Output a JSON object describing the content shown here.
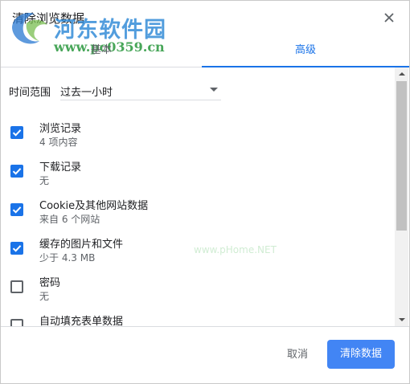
{
  "dialog": {
    "title": "清除浏览数据",
    "close_icon": "close-icon"
  },
  "watermark": {
    "name": "河东软件园",
    "url": "www.pc0359.cn",
    "faint": "www.pHome.NET"
  },
  "tabs": [
    {
      "label": "基本",
      "active": false
    },
    {
      "label": "高级",
      "active": true
    }
  ],
  "time_range": {
    "label": "时间范围",
    "value": "过去一小时"
  },
  "items": [
    {
      "title": "浏览记录",
      "subtitle": "4 项内容",
      "checked": true
    },
    {
      "title": "下载记录",
      "subtitle": "无",
      "checked": true
    },
    {
      "title": "Cookie及其他网站数据",
      "subtitle": "来自 6 个网站",
      "checked": true
    },
    {
      "title": "缓存的图片和文件",
      "subtitle": "少于 4.3 MB",
      "checked": true
    },
    {
      "title": "密码",
      "subtitle": "无",
      "checked": false
    },
    {
      "title": "自动填充表单数据",
      "subtitle": "",
      "checked": false
    }
  ],
  "footer": {
    "cancel_label": "取消",
    "clear_label": "清除数据"
  },
  "colors": {
    "accent": "#1a73e8",
    "primary_button": "#4285f4",
    "checkbox_checked": "#1a73e8"
  }
}
